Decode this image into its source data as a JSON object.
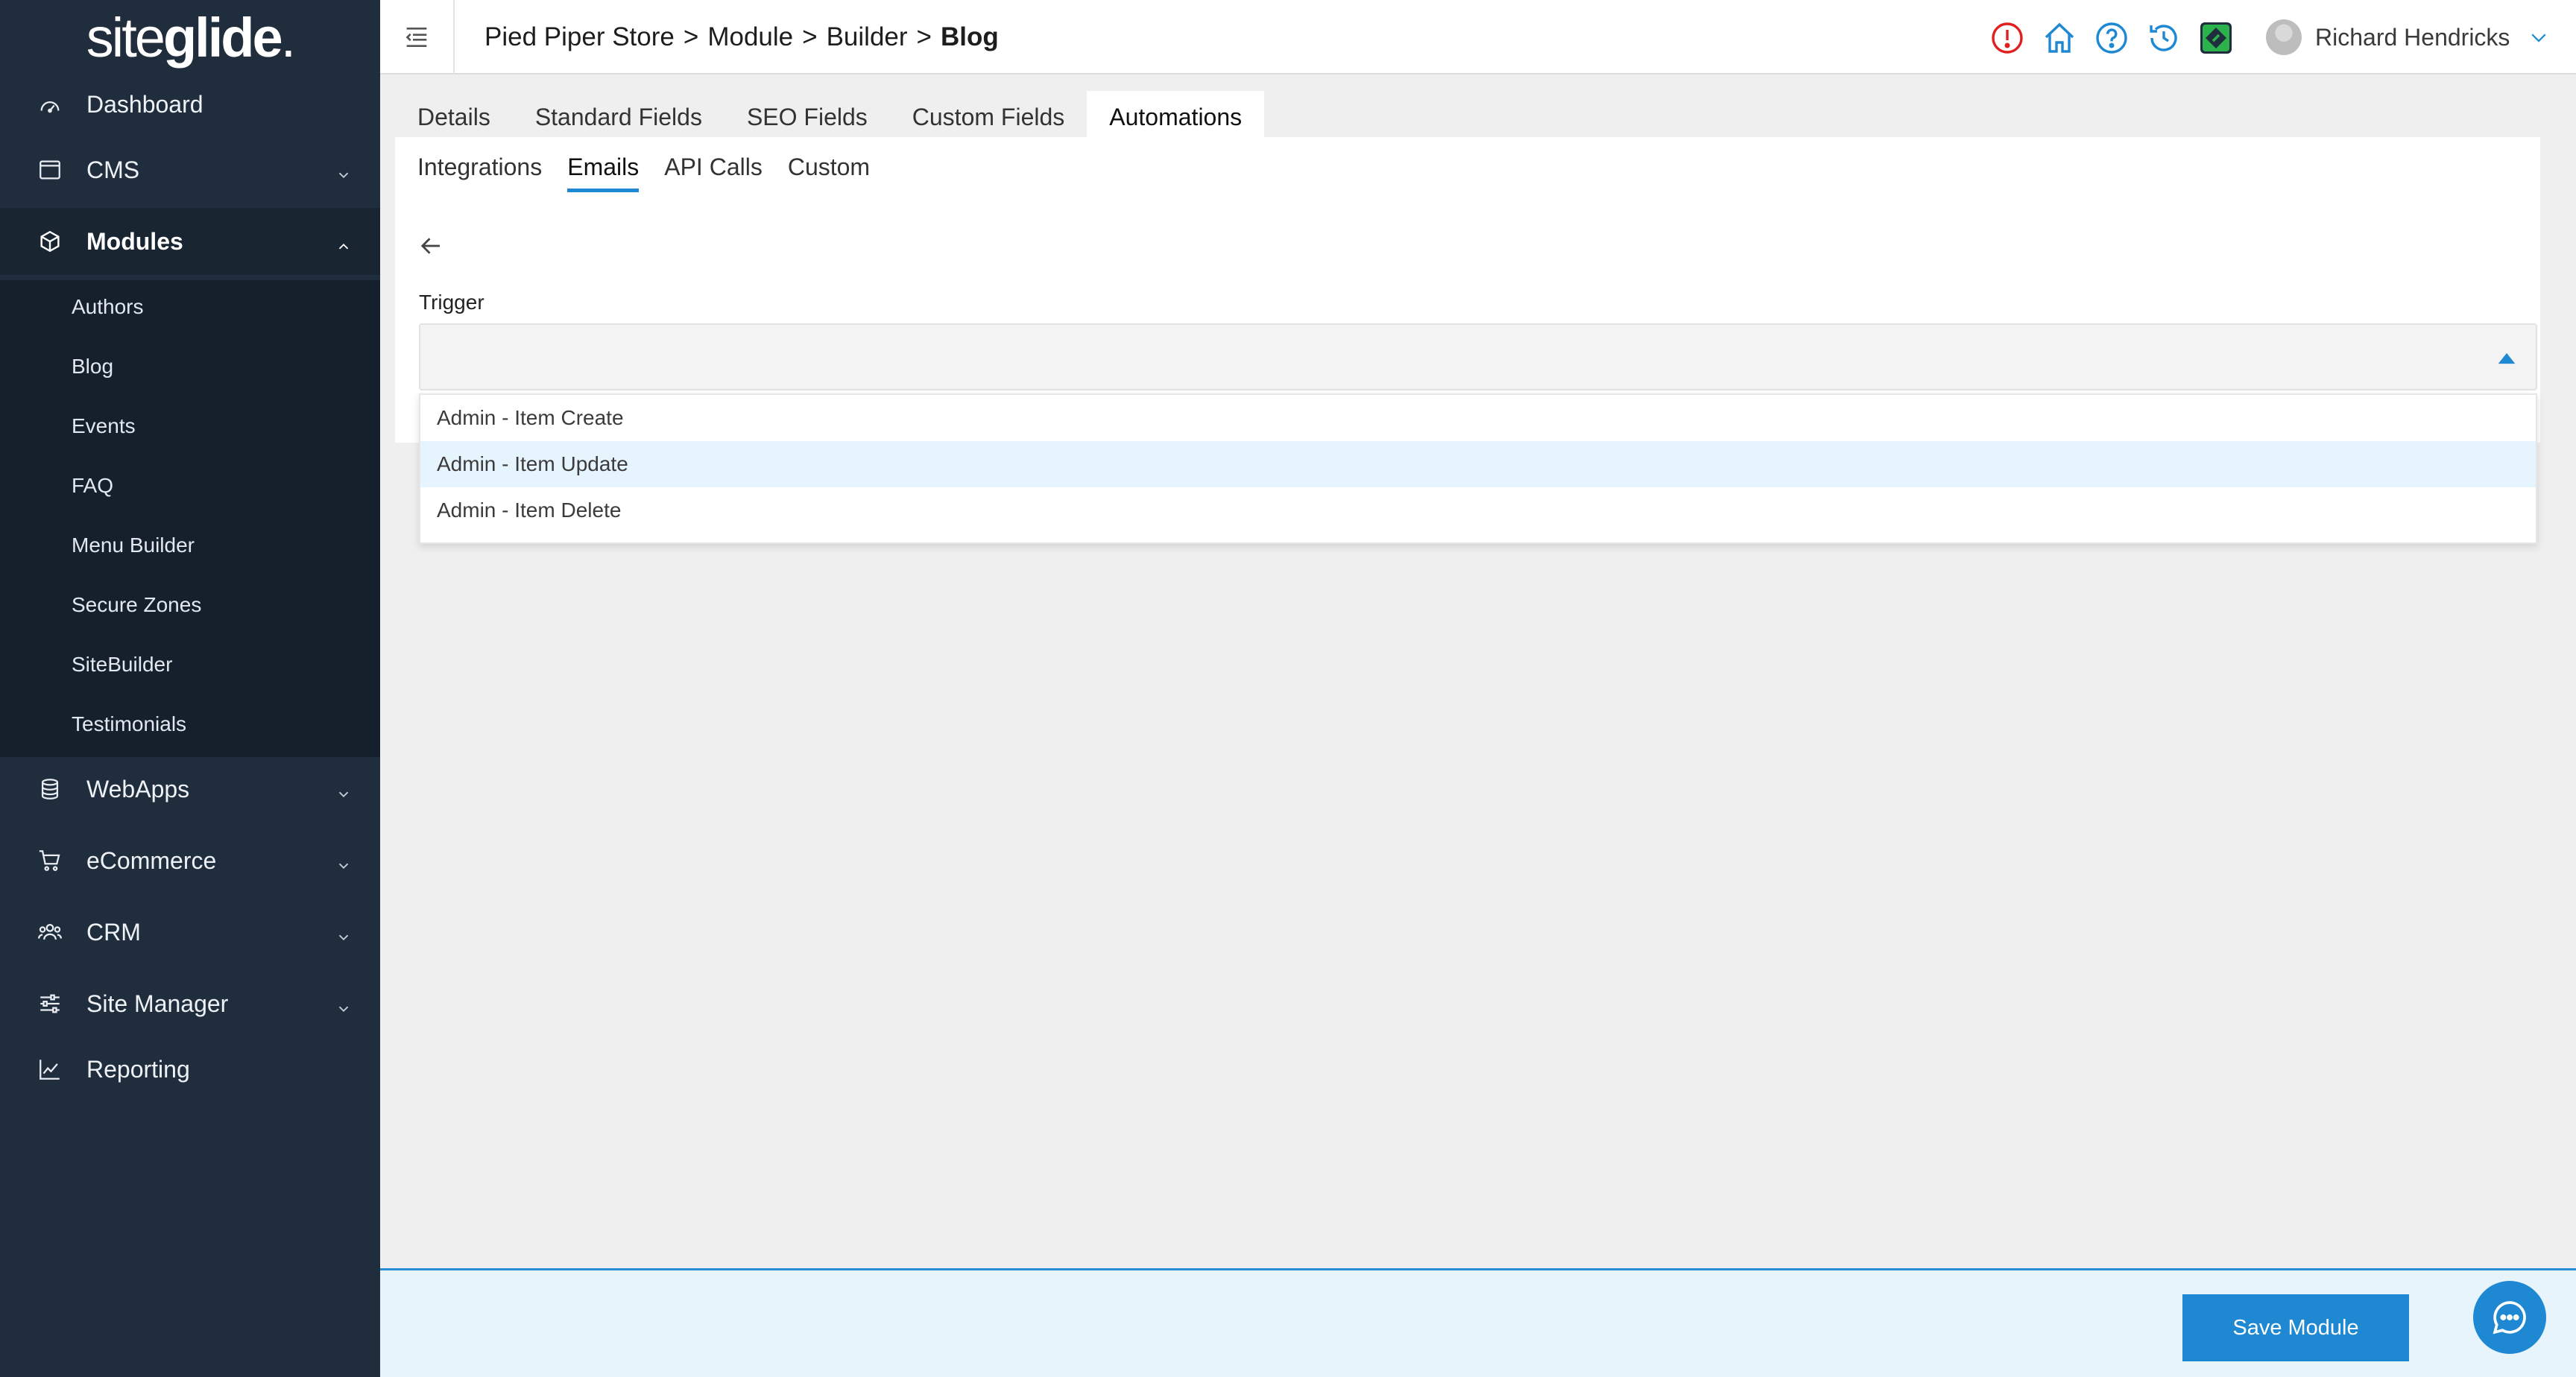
{
  "app": {
    "logo_part1": "site",
    "logo_part2": "glide",
    "logo_dot": "."
  },
  "sidebar": {
    "items": [
      {
        "label": "Dashboard",
        "icon": "dashboard-gauge-icon"
      },
      {
        "label": "CMS",
        "icon": "window-icon"
      },
      {
        "label": "Modules",
        "icon": "cube-icon"
      },
      {
        "label": "WebApps",
        "icon": "database-icon"
      },
      {
        "label": "eCommerce",
        "icon": "cart-icon"
      },
      {
        "label": "CRM",
        "icon": "people-icon"
      },
      {
        "label": "Site Manager",
        "icon": "sliders-icon"
      },
      {
        "label": "Reporting",
        "icon": "chart-line-icon"
      }
    ],
    "modules_subitems": [
      "Authors",
      "Blog",
      "Events",
      "FAQ",
      "Menu Builder",
      "Secure Zones",
      "SiteBuilder",
      "Testimonials"
    ]
  },
  "header": {
    "breadcrumb": [
      "Pied Piper Store",
      "Module",
      "Builder",
      "Blog"
    ],
    "separator": ">",
    "user_name": "Richard Hendricks",
    "icons": [
      "alert-icon",
      "home-icon",
      "help-icon",
      "history-icon",
      "siteglide-app-icon"
    ]
  },
  "tabs": [
    "Details",
    "Standard Fields",
    "SEO Fields",
    "Custom Fields",
    "Automations"
  ],
  "active_tab": "Automations",
  "subtabs": [
    "Integrations",
    "Emails",
    "API Calls",
    "Custom"
  ],
  "active_subtab": "Emails",
  "form": {
    "trigger_label": "Trigger",
    "trigger_value": "",
    "trigger_options": [
      "Admin - Item Create",
      "Admin - Item Update",
      "Admin - Item Delete"
    ],
    "highlighted_option": "Admin - Item Update"
  },
  "footer": {
    "save_label": "Save Module"
  },
  "colors": {
    "sidebar_bg": "#1f2d3d",
    "accent": "#1e88d3",
    "alert": "#e02020",
    "green_app": "#2bb24c"
  }
}
